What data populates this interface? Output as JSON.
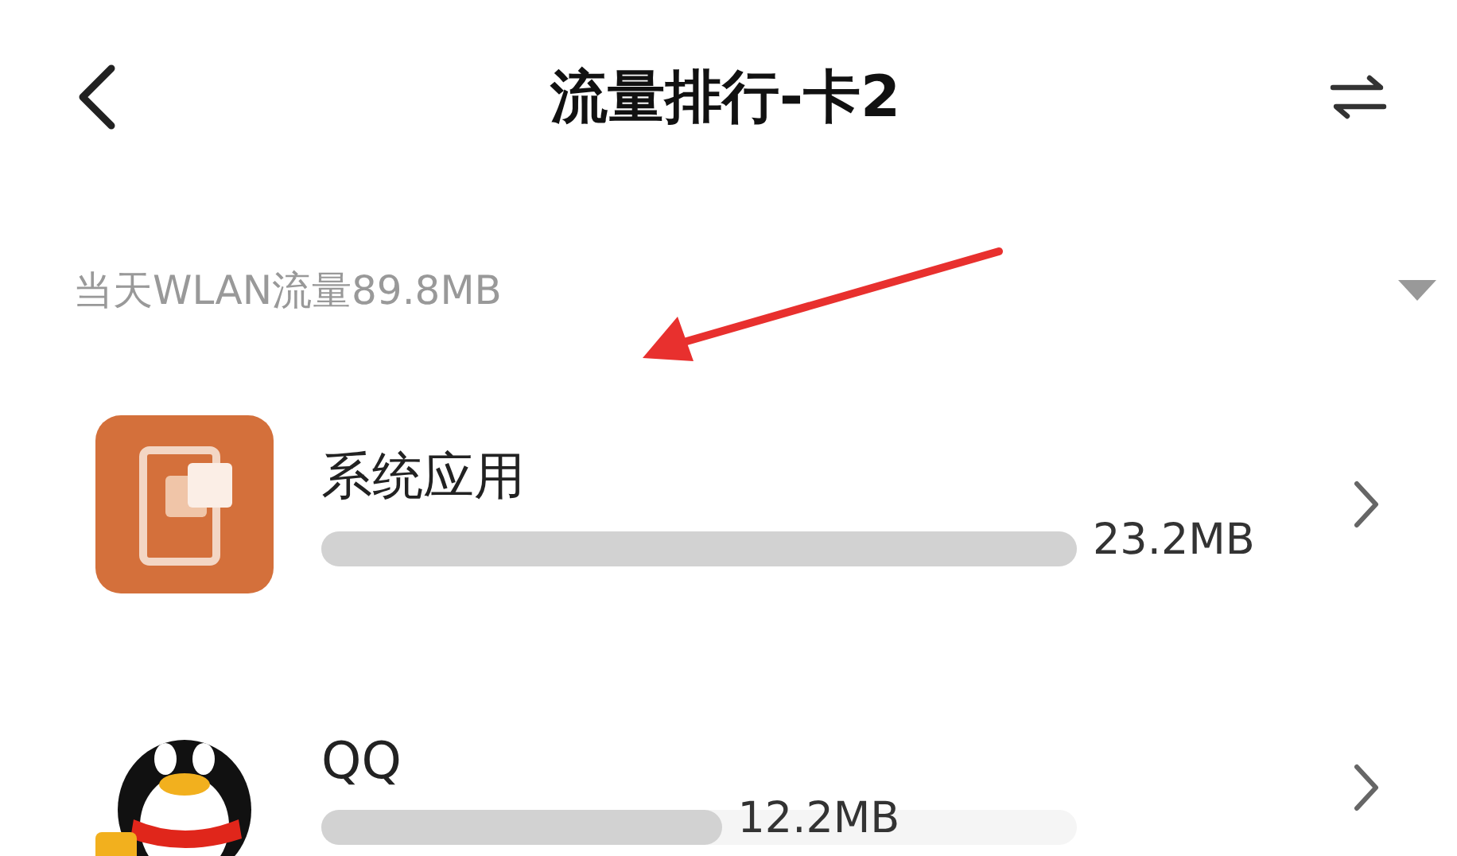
{
  "header": {
    "title": "流量排行-卡2"
  },
  "summary": {
    "text": "当天WLAN流量89.8MB",
    "expanded": false
  },
  "apps": [
    {
      "name": "系统应用",
      "kind": "system",
      "level": 1.0,
      "usage": "23.2MB"
    },
    {
      "name": "QQ",
      "kind": "qq",
      "level": 0.53,
      "usage": "12.2MB"
    }
  ]
}
